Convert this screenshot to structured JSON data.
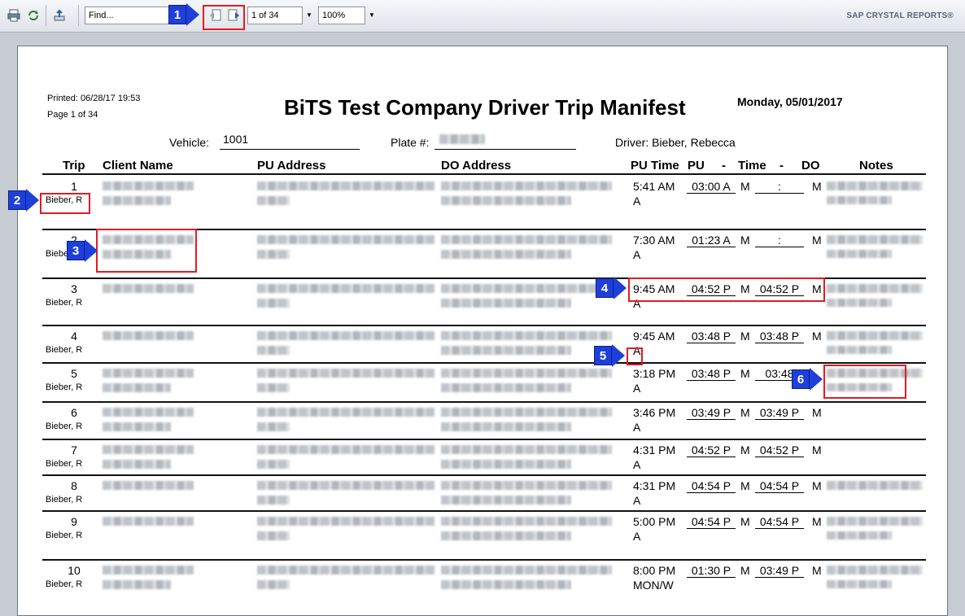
{
  "toolbar": {
    "find_placeholder": "Find...",
    "page_indicator": "1 of 34",
    "zoom": "100%",
    "brand": "SAP CRYSTAL REPORTS®"
  },
  "report": {
    "printed": "Printed: 06/28/17 19:53",
    "page": "Page 1 of 34",
    "title": "BiTS Test Company Driver Trip Manifest",
    "date": "Monday, 05/01/2017",
    "vehicle_label": "Vehicle:",
    "vehicle_value": "1001",
    "plate_label": "Plate #:",
    "driver": "Driver: Bieber, Rebecca",
    "columns": {
      "trip": "Trip",
      "client": "Client Name",
      "pu_address": "PU Address",
      "do_address": "DO Address",
      "pu_time": "PU Time",
      "pu": "PU",
      "dash1": "-",
      "time": "Time",
      "dash2": "-",
      "do": "DO",
      "notes": "Notes"
    },
    "rows": [
      {
        "trip": "1",
        "driver": "Bieber, R",
        "pu_time": "5:41 AM",
        "pu_time2": "A",
        "pu": "03:00 A",
        "m1": "M",
        "do": ":",
        "m2": "M"
      },
      {
        "trip": "2",
        "driver": "Bieber, R",
        "pu_time": "7:30 AM",
        "pu_time2": "A",
        "pu": "01:23 A",
        "m1": "M",
        "do": ":",
        "m2": "M"
      },
      {
        "trip": "3",
        "driver": "Bieber, R",
        "pu_time": "9:45 AM",
        "pu_time2": "A",
        "pu": "04:52 P",
        "m1": "M",
        "do": "04:52 P",
        "m2": "M"
      },
      {
        "trip": "4",
        "driver": "Bieber, R",
        "pu_time": "9:45 AM",
        "pu_time2": "A",
        "pu": "03:48 P",
        "m1": "M",
        "do": "03:48 P",
        "m2": "M"
      },
      {
        "trip": "5",
        "driver": "Bieber, R",
        "pu_time": "3:18 PM",
        "pu_time2": "A",
        "pu": "03:48 P",
        "m1": "M",
        "do": "03:48",
        "m2": ""
      },
      {
        "trip": "6",
        "driver": "Bieber, R",
        "pu_time": "3:46 PM",
        "pu_time2": "A",
        "pu": "03:49 P",
        "m1": "M",
        "do": "03:49 P",
        "m2": "M"
      },
      {
        "trip": "7",
        "driver": "Bieber, R",
        "pu_time": "4:31 PM",
        "pu_time2": "A",
        "pu": "04:52 P",
        "m1": "M",
        "do": "04:52 P",
        "m2": "M"
      },
      {
        "trip": "8",
        "driver": "Bieber, R",
        "pu_time": "4:31 PM",
        "pu_time2": "A",
        "pu": "04:54 P",
        "m1": "M",
        "do": "04:54 P",
        "m2": "M"
      },
      {
        "trip": "9",
        "driver": "Bieber, R",
        "pu_time": "5:00 PM",
        "pu_time2": "A",
        "pu": "04:54 P",
        "m1": "M",
        "do": "04:54 P",
        "m2": "M"
      },
      {
        "trip": "10",
        "driver": "Bieber, R",
        "pu_time": "8:00 PM",
        "pu_time2": "MON/W",
        "pu": "01:30 P",
        "m1": "M",
        "do": "03:49 P",
        "m2": "M"
      }
    ]
  },
  "callouts": [
    "1",
    "2",
    "3",
    "4",
    "5",
    "6"
  ],
  "colors": {
    "callout_blue": "#1e40d8",
    "highlight_red": "#e31b23"
  }
}
